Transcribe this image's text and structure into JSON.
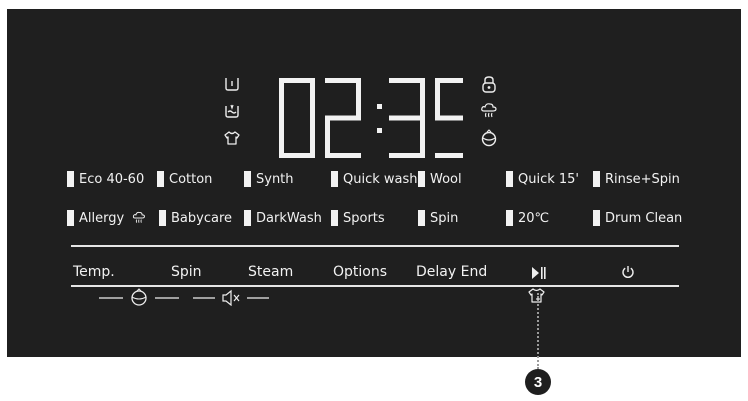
{
  "display": {
    "time": "02:35",
    "left_icons": [
      "detergent-icon",
      "prewash-icon",
      "shirt-icon"
    ],
    "right_icons": [
      "child-lock-icon",
      "steam-icon",
      "drum-icon"
    ]
  },
  "programs": {
    "row1": [
      {
        "label": "Eco 40-60"
      },
      {
        "label": "Cotton"
      },
      {
        "label": "Synth"
      },
      {
        "label": "Quick wash"
      },
      {
        "label": "Wool"
      },
      {
        "label": "Quick 15'"
      },
      {
        "label": "Rinse+Spin"
      }
    ],
    "row2": [
      {
        "label": "Allergy"
      },
      {
        "label": "Babycare"
      },
      {
        "label": "DarkWash"
      },
      {
        "label": "Sports"
      },
      {
        "label": "Spin"
      },
      {
        "label": "20℃"
      },
      {
        "label": "Drum Clean"
      }
    ]
  },
  "controls": {
    "temp": "Temp.",
    "spin": "Spin",
    "steam": "Steam",
    "options": "Options",
    "delay_end": "Delay End",
    "start_pause_icon": "play-pause-icon",
    "power_icon": "power-icon"
  },
  "below_icons": [
    "drum-clean-icon",
    "mute-icon",
    "add-garment-icon"
  ],
  "callout": {
    "number": "3"
  },
  "colors": {
    "panel": "#1f1f1f",
    "text": "#f2f2f2",
    "badge": "#1f1f1f"
  }
}
